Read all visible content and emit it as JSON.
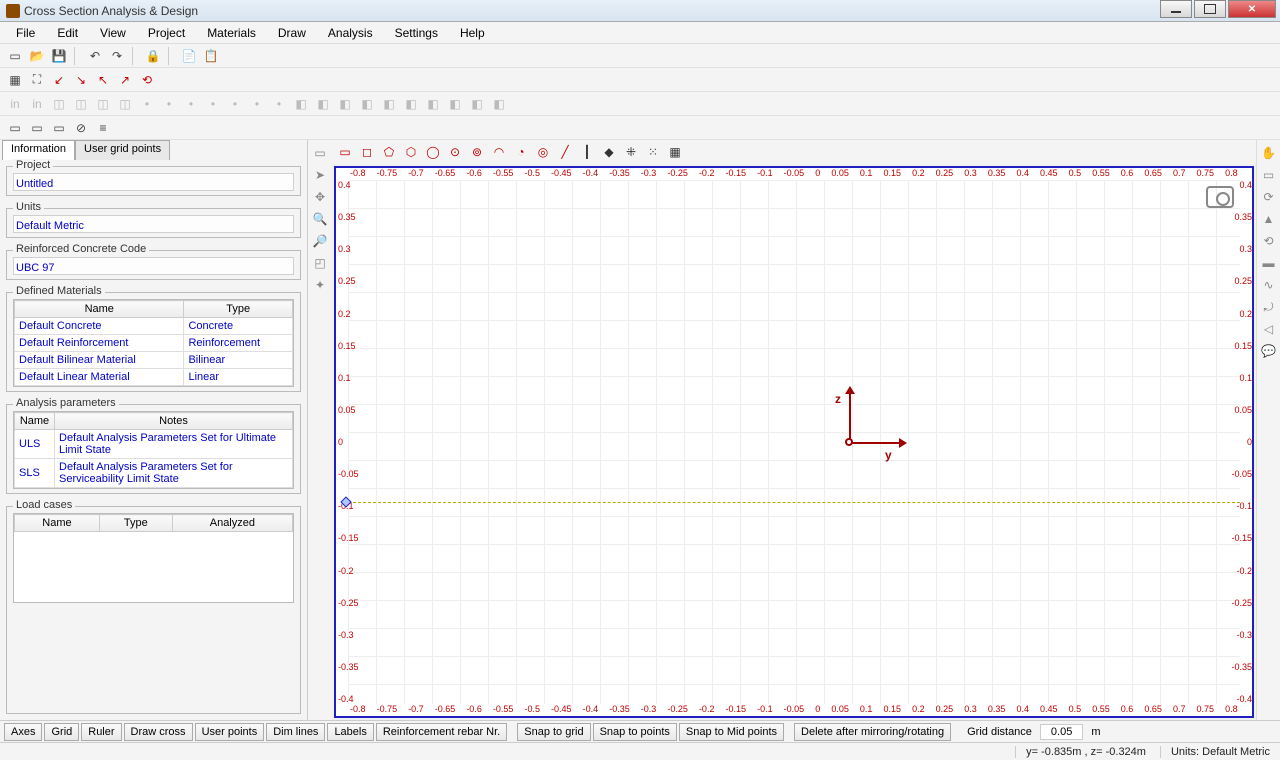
{
  "app_title": "Cross Section Analysis & Design",
  "menus": [
    "File",
    "Edit",
    "View",
    "Project",
    "Materials",
    "Draw",
    "Analysis",
    "Settings",
    "Help"
  ],
  "tabs": {
    "information": "Information",
    "user_grid": "User grid points"
  },
  "project": {
    "legend": "Project",
    "value": "Untitled"
  },
  "units": {
    "legend": "Units",
    "value": "Default Metric"
  },
  "rccode": {
    "legend": "Reinforced Concrete Code",
    "value": "UBC 97"
  },
  "materials": {
    "legend": "Defined Materials",
    "headers": [
      "Name",
      "Type"
    ],
    "rows": [
      {
        "name": "Default Concrete",
        "type": "Concrete"
      },
      {
        "name": "Default Reinforcement",
        "type": "Reinforcement"
      },
      {
        "name": "Default Bilinear Material",
        "type": "Bilinear"
      },
      {
        "name": "Default Linear Material",
        "type": "Linear"
      }
    ]
  },
  "analysis_params": {
    "legend": "Analysis parameters",
    "headers": [
      "Name",
      "Notes"
    ],
    "rows": [
      {
        "name": "ULS",
        "notes": "Default Analysis Parameters Set for Ultimate Limit State"
      },
      {
        "name": "SLS",
        "notes": "Default Analysis Parameters Set for Serviceability Limit State"
      }
    ]
  },
  "load_cases": {
    "legend": "Load cases",
    "headers": [
      "Name",
      "Type",
      "Analyzed"
    ]
  },
  "ruler": {
    "h": [
      "-0.8",
      "-0.75",
      "-0.7",
      "-0.65",
      "-0.6",
      "-0.55",
      "-0.5",
      "-0.45",
      "-0.4",
      "-0.35",
      "-0.3",
      "-0.25",
      "-0.2",
      "-0.15",
      "-0.1",
      "-0.05",
      "0",
      "0.05",
      "0.1",
      "0.15",
      "0.2",
      "0.25",
      "0.3",
      "0.35",
      "0.4",
      "0.45",
      "0.5",
      "0.55",
      "0.6",
      "0.65",
      "0.7",
      "0.75",
      "0.8"
    ],
    "v": [
      "0.4",
      "0.35",
      "0.3",
      "0.25",
      "0.2",
      "0.15",
      "0.1",
      "0.05",
      "0",
      "-0.05",
      "-0.1",
      "-0.15",
      "-0.2",
      "-0.25",
      "-0.3",
      "-0.35",
      "-0.4"
    ]
  },
  "axes": {
    "y": "y",
    "z": "z"
  },
  "toggles": [
    "Axes",
    "Grid",
    "Ruler",
    "Draw cross",
    "User points",
    "Dim lines",
    "Labels",
    "Reinforcement rebar Nr.",
    "Snap to grid",
    "Snap to points",
    "Snap to Mid points",
    "Delete after mirroring/rotating"
  ],
  "grid_distance": {
    "label": "Grid distance",
    "value": "0.05",
    "unit": "m"
  },
  "status": {
    "coords": "y= -0.835m , z= -0.324m",
    "units": "Units: Default Metric"
  }
}
